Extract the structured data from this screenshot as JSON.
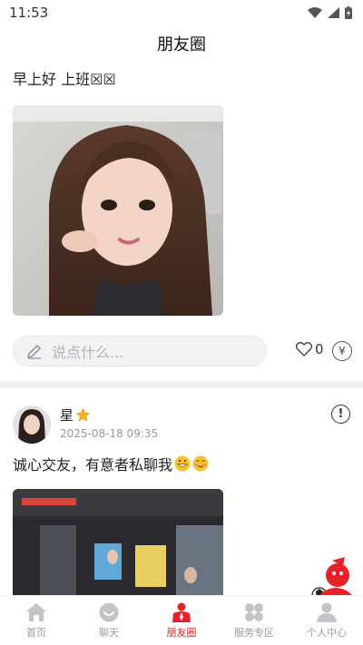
{
  "status_bar": {
    "time": "11:53"
  },
  "header": {
    "title": "朋友圈"
  },
  "post1": {
    "text": "早上好 上班☒☒",
    "comment_placeholder": "说点什么...",
    "like_count": "0",
    "reward_symbol": "¥"
  },
  "post2": {
    "name": "星",
    "time": "2025-08-18 09:35",
    "text": "诚心交友，有意者私聊我"
  },
  "bottom_nav": {
    "items": [
      {
        "label": "首页",
        "icon": "home-icon"
      },
      {
        "label": "聊天",
        "icon": "chat-icon"
      },
      {
        "label": "朋友圈",
        "icon": "moments-icon"
      },
      {
        "label": "服务专区",
        "icon": "services-icon"
      },
      {
        "label": "个人中心",
        "icon": "profile-icon"
      }
    ],
    "active_index": 2
  },
  "colors": {
    "accent": "#e8202a",
    "inactive": "#9a9a9a",
    "divider": "#f1f1f4"
  }
}
